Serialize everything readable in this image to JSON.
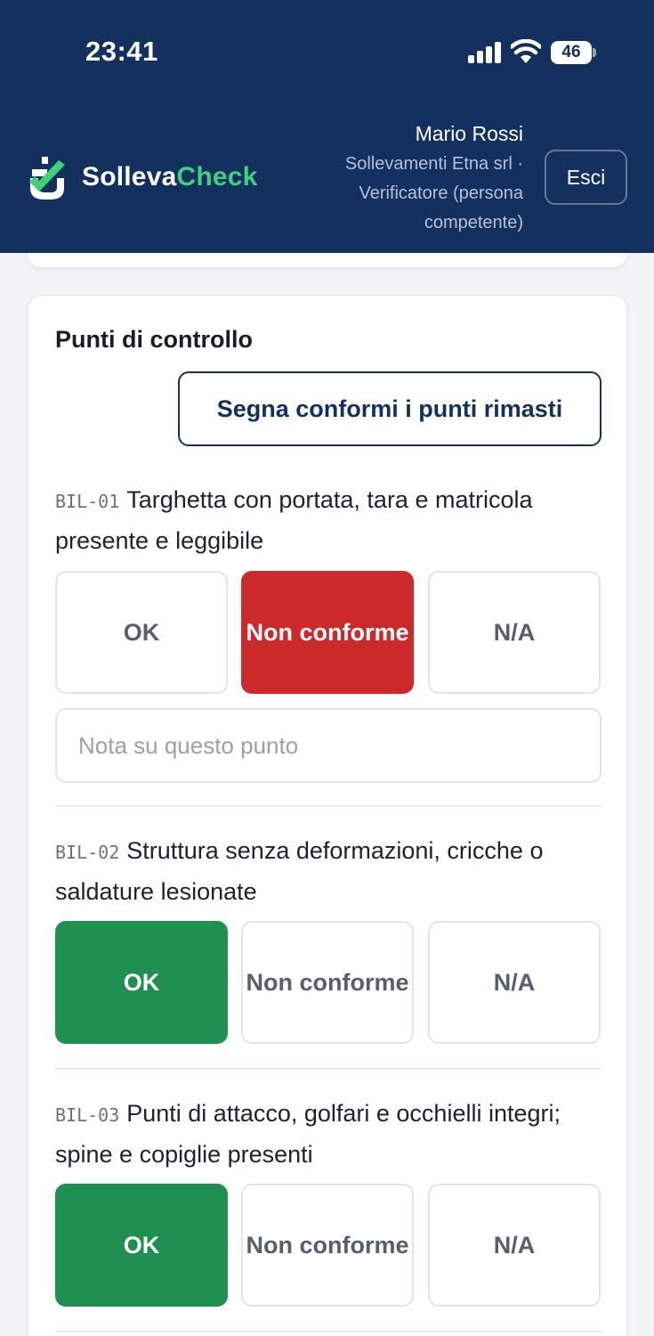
{
  "status_bar": {
    "time": "23:41",
    "battery": "46",
    "icons": [
      "signal-icon",
      "wifi-icon",
      "battery-icon"
    ]
  },
  "header": {
    "brand_part1": "Solleva",
    "brand_part2": "Check",
    "logo_icon": "shield-check-icon",
    "user_name": "Mario Rossi",
    "user_org": "Sollevamenti Etna srl · Verificatore (persona competente)",
    "logout_label": "Esci",
    "colors": {
      "background": "#13305f",
      "accent": "#3fd07a"
    }
  },
  "checklist": {
    "title": "Punti di controllo",
    "mark_all_label": "Segna conformi i punti rimasti",
    "option_labels": {
      "ok": "OK",
      "nc": "Non conforme",
      "na": "N/A"
    },
    "colors": {
      "ok_selected": "#208f52",
      "nc_selected": "#cc2a2a"
    },
    "items": [
      {
        "code": "BIL-01",
        "text": "Targhetta con portata, tara e matricola presente e leggibile",
        "selected": "nc",
        "note_placeholder": "Nota su questo punto",
        "note_value": ""
      },
      {
        "code": "BIL-02",
        "text": "Struttura senza deformazioni, cricche o saldature lesionate",
        "selected": "ok"
      },
      {
        "code": "BIL-03",
        "text": "Punti di attacco, golfari e occhielli integri; spine e copiglie presenti",
        "selected": "ok"
      }
    ]
  }
}
